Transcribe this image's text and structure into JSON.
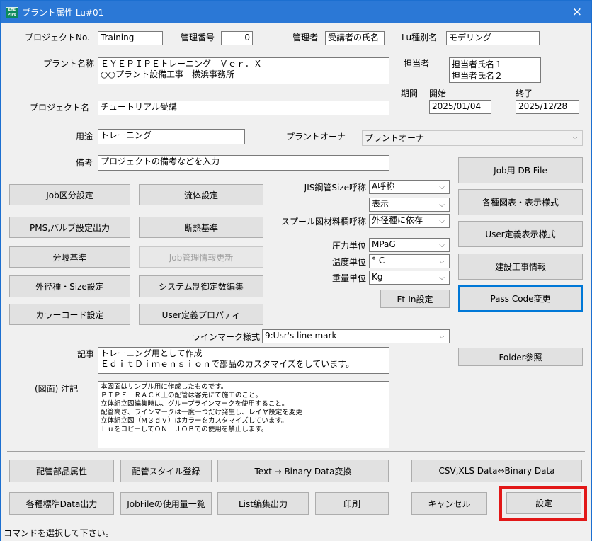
{
  "window": {
    "title": "プラント属性 Lu#01",
    "close_glyph": "×",
    "icon_text": "EYE PIPE"
  },
  "project_no": {
    "label": "プロジェクトNo.",
    "value": "Training"
  },
  "mgmt_no": {
    "label": "管理番号",
    "value": "0"
  },
  "manager": {
    "label": "管理者",
    "value": "受講者の氏名"
  },
  "lu_type": {
    "label": "Lu種別名",
    "value": "モデリング"
  },
  "plant_name": {
    "label": "プラント名称",
    "value": "ＥＹＥＰＩＰＥトレーニング　Ｖｅｒ．Ｘ\n○○プラント設備工事　横浜事務所"
  },
  "person": {
    "label": "担当者",
    "value": "担当者氏名１\n担当者氏名２"
  },
  "period": {
    "label": "期間",
    "start_label": "開始",
    "end_label": "終了",
    "start": "2025/01/04",
    "dash": "–",
    "end": "2025/12/28"
  },
  "project_name": {
    "label": "プロジェクト名",
    "value": "チュートリアル受講"
  },
  "usage": {
    "label": "用途",
    "value": "トレーニング"
  },
  "plant_owner": {
    "label": "プラントオーナ",
    "value": "プラントオーナ"
  },
  "remarks": {
    "label": "備考",
    "value": "プロジェクトの備考などを入力"
  },
  "jis_size": {
    "label": "JIS鋼管Size呼称",
    "value": "A呼称"
  },
  "display": {
    "value": "表示"
  },
  "spool": {
    "label": "スプール図材料欄呼称",
    "value": "外径種に依存"
  },
  "pressure": {
    "label": "圧力単位",
    "value": "MPaG"
  },
  "temperature": {
    "label": "温度単位",
    "value": "° C"
  },
  "weight": {
    "label": "重量単位",
    "value": "Kg"
  },
  "line_mark": {
    "label": "ラインマーク様式",
    "value": "9:Usr's line mark"
  },
  "article": {
    "label": "記事",
    "value": "トレーニング用として作成\nＥｄｉｔＤｉｍｅｎｓｉｏｎで部品のカスタマイズをしています。"
  },
  "drawing_note": {
    "label": "(図面) 注記",
    "value": "本図面はサンプル用に作成したものです。\nＰＩＰＥ　ＲＡＣＫ上の配管は客先にて施工のこと。\n立体組立図編集時は、グループラインマークを使用すること。\n配管高さ、ラインマークは一度一つだけ発生し、レイヤ設定を変更\n立体組立図（Ｍ３ｄｖ）はカラーをカスタマイズしています。\nＬｕをコピーしてＯＮ　ＪＯＢでの使用を禁止します。"
  },
  "buttons": {
    "job_div": "Job区分設定",
    "fluid": "流体設定",
    "pms": "PMS,バルブ設定出力",
    "insulation": "断熱基準",
    "branch": "分岐基準",
    "job_info": "Job管理情報更新",
    "od_size": "外径種・Size設定",
    "sys_const": "システム制御定数編集",
    "color_code": "カラーコード設定",
    "user_prop": "User定義プロパティ",
    "ft_in": "Ft-In設定",
    "job_db": "Job用 DB File",
    "diagrams": "各種図表・表示様式",
    "user_disp": "User定義表示様式",
    "construction": "建設工事情報",
    "pass_code": "Pass Code変更",
    "folder": "Folder参照",
    "parts_attr": "配管部品属性",
    "style_reg": "配管スタイル登録",
    "text_bin": "Text → Binary Data変換",
    "csv_bin": "CSV,XLS Data⇔Binary Data",
    "std_data": "各種標準Data出力",
    "jobfile_usage": "JobFileの使用量一覧",
    "list_edit": "List編集出力",
    "print": "印刷",
    "cancel": "キャンセル",
    "ok": "設定"
  },
  "status": "コマンドを選択して下さい。",
  "colors": {
    "titlebar": "#2b78d6",
    "highlight": "#e21818",
    "default_button_border": "#0078d7"
  }
}
